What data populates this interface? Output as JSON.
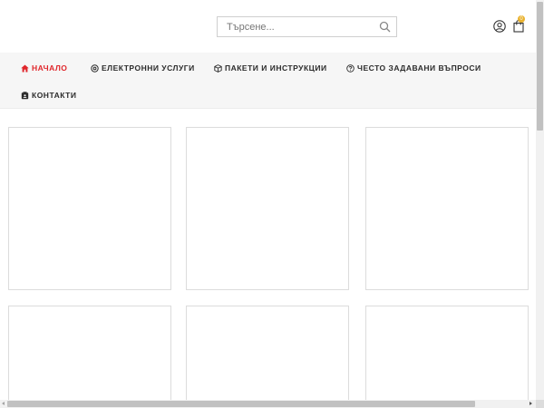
{
  "search": {
    "placeholder": "Търсене..."
  },
  "cart": {
    "count": "0"
  },
  "nav": {
    "items": [
      {
        "label": "НАЧАЛО",
        "icon": "home-icon",
        "active": true
      },
      {
        "label": "ЕЛЕКТРОННИ УСЛУГИ",
        "icon": "at-icon",
        "active": false
      },
      {
        "label": "ПАКЕТИ И ИНСТРУКЦИИ",
        "icon": "package-icon",
        "active": false
      },
      {
        "label": "ЧЕСТО ЗАДАВАНИ ВЪПРОСИ",
        "icon": "question-icon",
        "active": false
      },
      {
        "label": "КОНТАКТИ",
        "icon": "contacts-icon",
        "active": false
      }
    ]
  },
  "colors": {
    "accent": "#e0262b",
    "badge": "#e9b22f",
    "nav_background": "#f6f6f6",
    "card_border": "#dcdcdc"
  }
}
